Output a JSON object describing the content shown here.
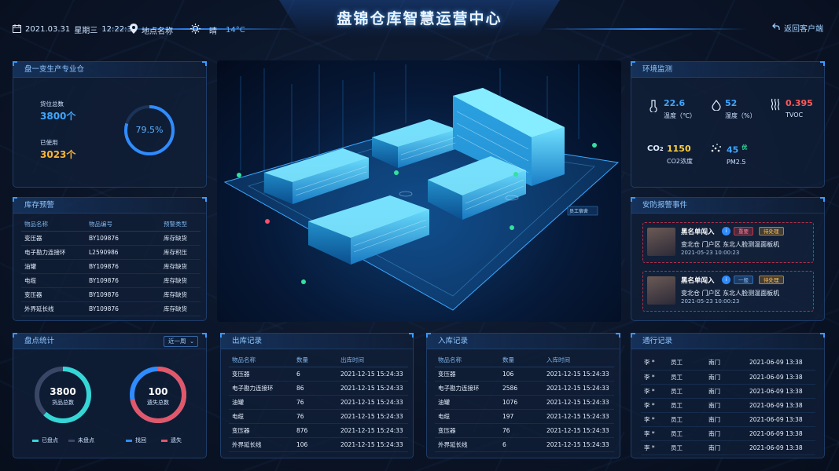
{
  "header": {
    "title": "盘锦仓库智慧运营中心",
    "date": "2021.03.31",
    "weekday": "星期三",
    "time": "12:22:31",
    "location": "地点名称",
    "weather": "晴",
    "temperature": "14°C",
    "back_label": "返回客户端"
  },
  "production": {
    "title": "盘一变生产专业仓",
    "total_label": "货位总数",
    "total_value": "3800个",
    "used_label": "已使用",
    "used_value": "3023个",
    "usage_percent_text": "79.5%",
    "usage_fraction": 0.795,
    "colors": {
      "total": "#3ea6ff",
      "used": "#ffb62e",
      "ring": "#2f8cff"
    }
  },
  "stock_alert": {
    "title": "库存预警",
    "columns": [
      "物品名称",
      "物品编号",
      "预警类型"
    ],
    "rows": [
      [
        "变压器",
        "BY109876",
        "库存缺货"
      ],
      [
        "电子勘力连接环",
        "L2590986",
        "库存积压"
      ],
      [
        "油罐",
        "BY109876",
        "库存缺货"
      ],
      [
        "电缆",
        "BY109876",
        "库存缺货"
      ],
      [
        "变压器",
        "BY109876",
        "库存缺货"
      ],
      [
        "外界延长线",
        "BY109876",
        "库存缺货"
      ]
    ]
  },
  "inventory": {
    "title": "盘点统计",
    "filter": "近一周",
    "donut1": {
      "value": "3800",
      "label": "货品总数",
      "fraction": 0.62,
      "color_a": "#35d6d6",
      "color_b": "#3a4666"
    },
    "donut2": {
      "value": "100",
      "label": "遗失总数",
      "fraction": 0.72,
      "color_a": "#e0586a",
      "color_b": "#2f8cff"
    },
    "legend": [
      {
        "label": "已盘点",
        "color": "#35d6d6"
      },
      {
        "label": "未盘点",
        "color": "#3a4666"
      },
      {
        "label": "找回",
        "color": "#2f8cff"
      },
      {
        "label": "遗失",
        "color": "#e0586a"
      }
    ]
  },
  "outbound": {
    "title": "出库记录",
    "columns": [
      "物品名称",
      "数量",
      "出库时间"
    ],
    "rows": [
      [
        "变压器",
        "6",
        "2021-12-15 15:24:33"
      ],
      [
        "电子勘力连接环",
        "86",
        "2021-12-15 15:24:33"
      ],
      [
        "油罐",
        "76",
        "2021-12-15 15:24:33"
      ],
      [
        "电缆",
        "76",
        "2021-12-15 15:24:33"
      ],
      [
        "变压器",
        "876",
        "2021-12-15 15:24:33"
      ],
      [
        "外界延长线",
        "106",
        "2021-12-15 15:24:33"
      ]
    ]
  },
  "inbound": {
    "title": "入库记录",
    "columns": [
      "物品名称",
      "数量",
      "入库时间"
    ],
    "rows": [
      [
        "变压器",
        "106",
        "2021-12-15 15:24:33"
      ],
      [
        "电子勘力连接环",
        "2586",
        "2021-12-15 15:24:33"
      ],
      [
        "油罐",
        "1076",
        "2021-12-15 15:24:33"
      ],
      [
        "电缆",
        "197",
        "2021-12-15 15:24:33"
      ],
      [
        "变压器",
        "76",
        "2021-12-15 15:24:33"
      ],
      [
        "外界延长线",
        "6",
        "2021-12-15 15:24:33"
      ]
    ]
  },
  "environment": {
    "title": "环境监测",
    "items": [
      {
        "value": "22.6",
        "label": "温度（℃）",
        "color": "#3ea6ff",
        "icon": "thermometer-icon"
      },
      {
        "value": "52",
        "label": "湿度（%）",
        "color": "#3ea6ff",
        "icon": "humidity-icon"
      },
      {
        "value": "0.395",
        "label": "TVOC",
        "color": "#ff5a5a",
        "icon": "tvoc-icon"
      },
      {
        "value": "1150",
        "label": "CO2浓度",
        "color": "#ffd23f",
        "icon": "co2-icon"
      },
      {
        "value": "45",
        "label": "PM2.5",
        "color": "#3ea6ff",
        "icon": "pm25-icon",
        "grade": "优"
      }
    ]
  },
  "security": {
    "title": "安防报警事件",
    "events": [
      {
        "name": "黑名单闯入",
        "level": "重要",
        "status": "待处理",
        "location": "变北仓  门户区  东北人脸测温面板机",
        "time": "2021-05-23 10:00:23",
        "level_color": "#c0394a"
      },
      {
        "name": "黑名单闯入",
        "level": "一般",
        "status": "待处理",
        "location": "变北仓  门户区  东北人脸测温面板机",
        "time": "2021-05-23 10:00:23",
        "level_color": "#2f6fb8"
      }
    ]
  },
  "passage": {
    "title": "通行记录",
    "rows": [
      [
        "李 *",
        "员工",
        "南门",
        "2021-06-09 13:38"
      ],
      [
        "李 *",
        "员工",
        "南门",
        "2021-06-09 13:38"
      ],
      [
        "李 *",
        "员工",
        "南门",
        "2021-06-09 13:38"
      ],
      [
        "李 *",
        "员工",
        "南门",
        "2021-06-09 13:38"
      ],
      [
        "李 *",
        "员工",
        "南门",
        "2021-06-09 13:38"
      ],
      [
        "李 *",
        "员工",
        "南门",
        "2021-06-09 13:38"
      ],
      [
        "李 *",
        "员工",
        "南门",
        "2021-06-09 13:38"
      ]
    ]
  },
  "scene": {
    "tag_label": "员工宿舍"
  }
}
